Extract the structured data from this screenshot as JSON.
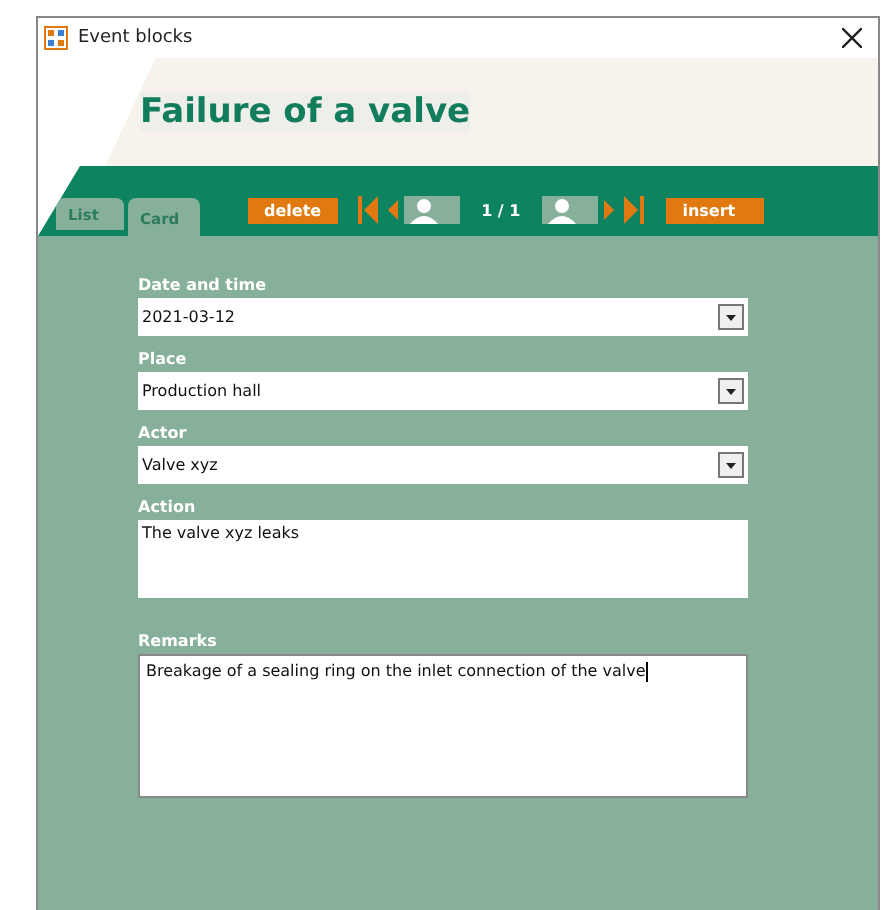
{
  "window": {
    "title": "Event blocks"
  },
  "header": {
    "title": "Failure of a valve"
  },
  "tabs": [
    {
      "label": "List",
      "selected": false
    },
    {
      "label": "Card",
      "selected": true
    }
  ],
  "toolbar": {
    "delete": "delete",
    "position": "1 / 1",
    "insert": "insert"
  },
  "fields": [
    {
      "label": "Date and time",
      "value": "2021-03-12",
      "kind": "dropdown"
    },
    {
      "label": "Place",
      "value": "Production hall",
      "kind": "dropdown"
    },
    {
      "label": "Actor",
      "value": "Valve xyz",
      "kind": "dropdown"
    },
    {
      "label": "Action",
      "value": "The valve xyz leaks",
      "kind": "memo"
    },
    {
      "label": "Remarks",
      "value": "Breakage of a sealing ring on the inlet connection of the valve",
      "kind": "memo-focused"
    }
  ]
}
